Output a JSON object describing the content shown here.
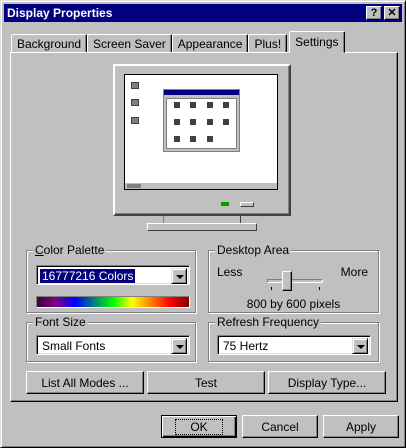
{
  "window": {
    "title": "Display Properties",
    "help_button": "?",
    "close_button": "✕"
  },
  "tabs": [
    {
      "label": "Background"
    },
    {
      "label": "Screen Saver"
    },
    {
      "label": "Appearance"
    },
    {
      "label": "Plus!"
    },
    {
      "label": "Settings",
      "active": true
    }
  ],
  "color_palette": {
    "group_label": "Color Palette",
    "selected": "16777216 Colors"
  },
  "desktop_area": {
    "group_label": "Desktop Area",
    "less_label": "Less",
    "more_label": "More",
    "resolution": "800 by 600 pixels",
    "slider_position": 0.35
  },
  "font_size": {
    "group_label": "Font Size",
    "selected": "Small Fonts"
  },
  "refresh_frequency": {
    "group_label": "Refresh Frequency",
    "selected": "75 Hertz"
  },
  "actions": {
    "list_modes": "List All Modes ...",
    "test": "Test",
    "display_type": "Display Type..."
  },
  "footer": {
    "ok": "OK",
    "cancel": "Cancel",
    "apply": "Apply"
  },
  "colors": {
    "titlebar": "#000080",
    "face": "#c0c0c0",
    "highlight": "#000080"
  }
}
